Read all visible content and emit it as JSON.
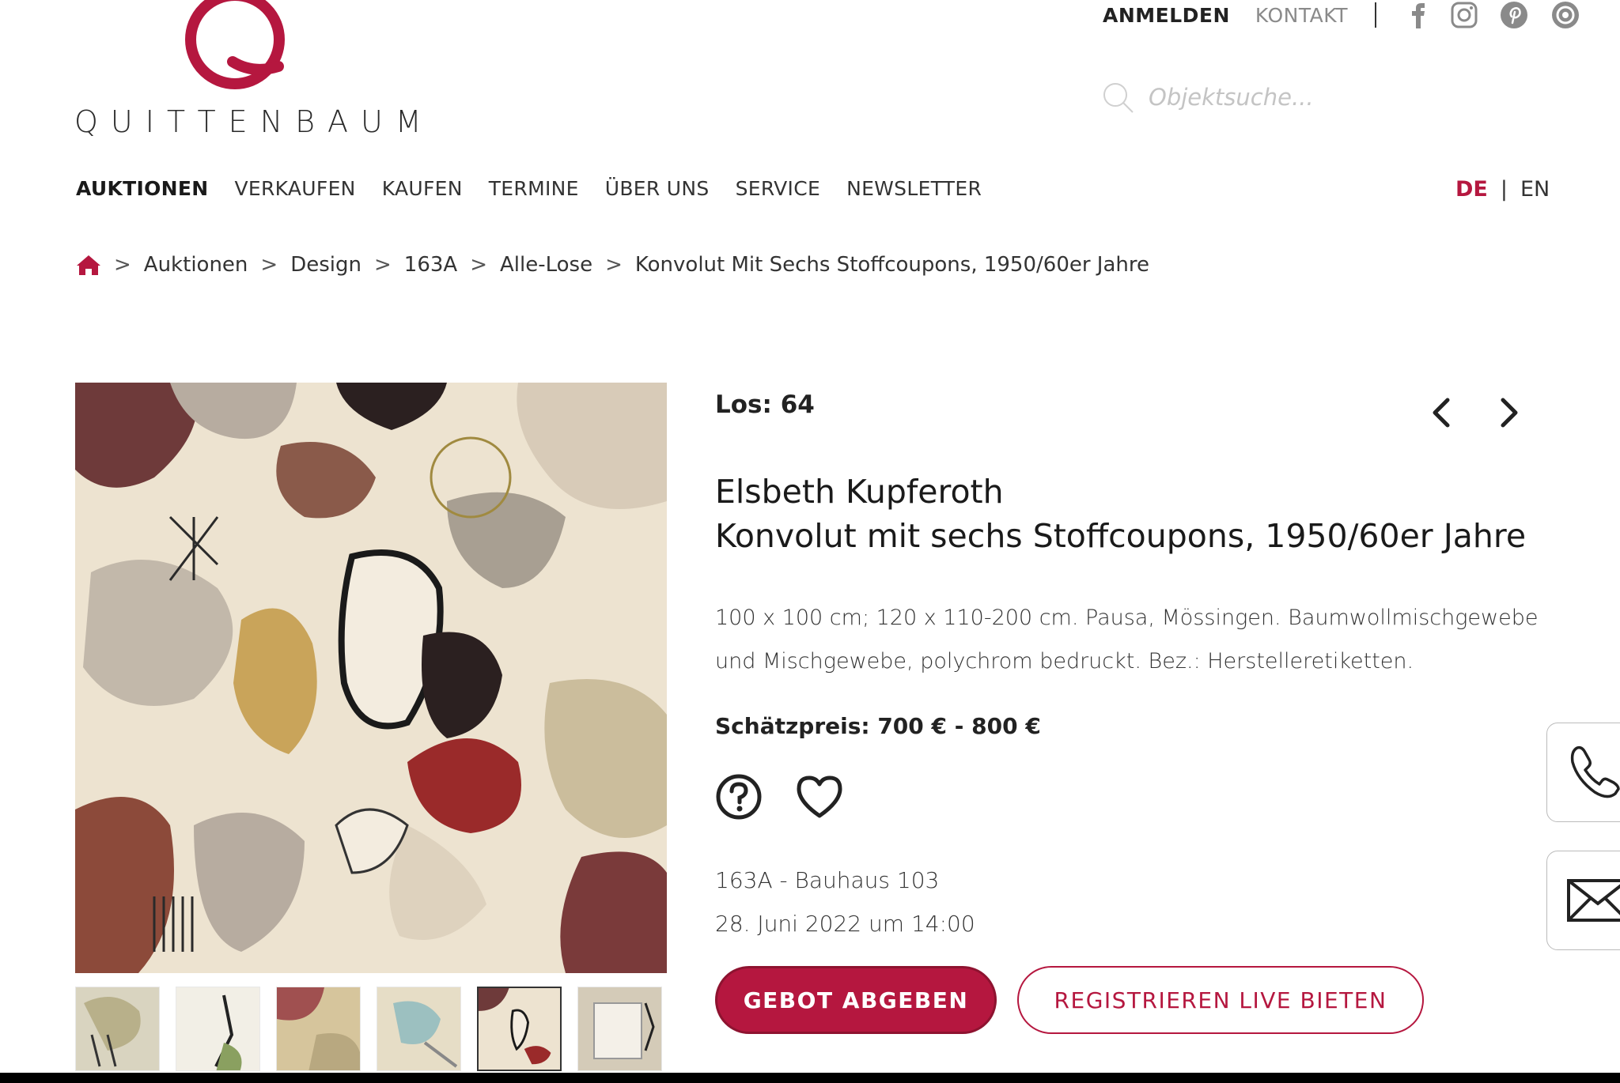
{
  "header": {
    "logo_text": "QUITTENBAUM",
    "login_label": "ANMELDEN",
    "contact_label": "KONTAKT",
    "social_icons": [
      "facebook-icon",
      "instagram-icon",
      "pinterest-icon",
      "circle-logo-icon"
    ],
    "search_placeholder": "Objektsuche..."
  },
  "nav": {
    "items": [
      "AUKTIONEN",
      "VERKAUFEN",
      "KAUFEN",
      "TERMINE",
      "ÜBER UNS",
      "SERVICE",
      "NEWSLETTER"
    ],
    "active": "AUKTIONEN",
    "lang_de": "DE",
    "lang_sep": "|",
    "lang_en": "EN"
  },
  "breadcrumb": {
    "separator": ">",
    "items": [
      "Auktionen",
      "Design",
      "163A",
      "Alle-Lose",
      "Konvolut Mit Sechs Stoffcoupons, 1950/60er Jahre"
    ]
  },
  "lot": {
    "number_label": "Los: 64",
    "artist": "Elsbeth Kupferoth",
    "title": "Konvolut mit sechs Stoffcoupons, 1950/60er Jahre",
    "description": "100 x 100 cm; 120 x 110-200 cm. Pausa, Mössingen. Baumwollmischgewebe und Mischgewebe, polychrom bedruckt. Bez.: Herstelleretiketten.",
    "estimate": "Schätzpreis: 700 € - 800 €",
    "sale_name": "163A - Bauhaus 103",
    "sale_date": "28. Juni 2022 um 14:00"
  },
  "buttons": {
    "bid": "GEBOT ABGEBEN",
    "live": "REGISTRIEREN LIVE BIETEN"
  },
  "colors": {
    "brand": "#b5173f"
  }
}
